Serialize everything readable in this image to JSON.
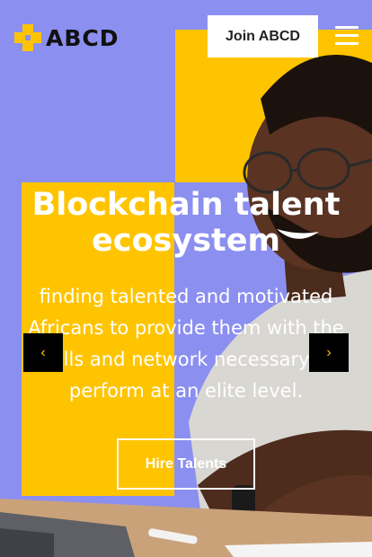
{
  "brand": {
    "name": "ABCD",
    "logo_icon": "abcd-logo-icon",
    "accent": "#ffc400",
    "background": "#8b8ff0"
  },
  "header": {
    "join_label": "Join ABCD",
    "menu_icon": "hamburger-menu-icon"
  },
  "hero": {
    "headline": "Blockchain talent ecosystem",
    "subtext": "finding talented and motivated Africans to provide them with the skills and network necessary to perform at an elite level.",
    "cta_label": "Hire Talents",
    "prev_label": "‹",
    "next_label": "›"
  }
}
